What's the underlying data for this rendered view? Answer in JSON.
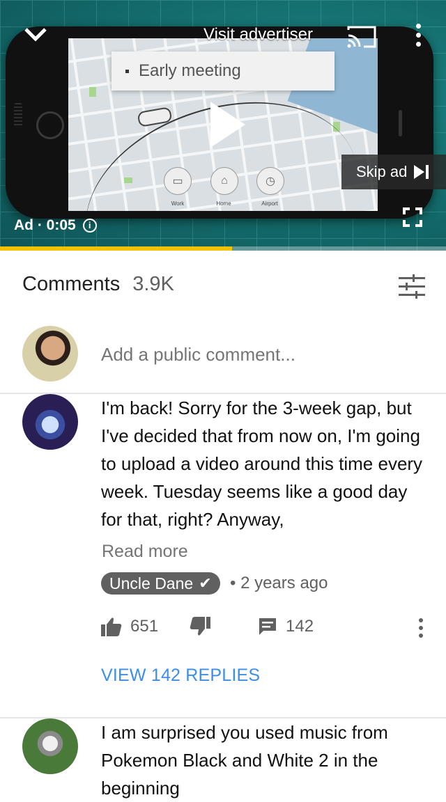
{
  "video": {
    "visit_advertiser": "Visit advertiser",
    "skip_ad": "Skip ad",
    "ad_time": "Ad · 0:05",
    "progress_fraction": 0.52,
    "screen": {
      "search_text": "Early meeting",
      "destinations": [
        "Work",
        "Home",
        "Airport"
      ]
    },
    "icons": [
      "chevron-down-icon",
      "cast-icon",
      "more-vert-icon",
      "play-icon",
      "skip-next-icon",
      "info-icon",
      "fullscreen-icon"
    ]
  },
  "comments": {
    "title": "Comments",
    "count": "3.9K",
    "add_placeholder": "Add a public comment...",
    "items": [
      {
        "text": "I'm back! Sorry for the 3-week gap, but I've decided that from now on, I'm going to upload a video around this time every week. Tuesday seems like a good day for that, right? Anyway,",
        "read_more": "Read more",
        "author": "Uncle Dane",
        "time": "• 2 years ago",
        "likes": "651",
        "replies_count": "142",
        "view_replies": "VIEW 142 REPLIES"
      },
      {
        "text": "I am surprised you used music from Pokemon Black and White 2 in the beginning"
      }
    ]
  },
  "colors": {
    "progress": "#f2c200",
    "link_blue": "#3d8ee8",
    "author_pill": "#606060"
  }
}
